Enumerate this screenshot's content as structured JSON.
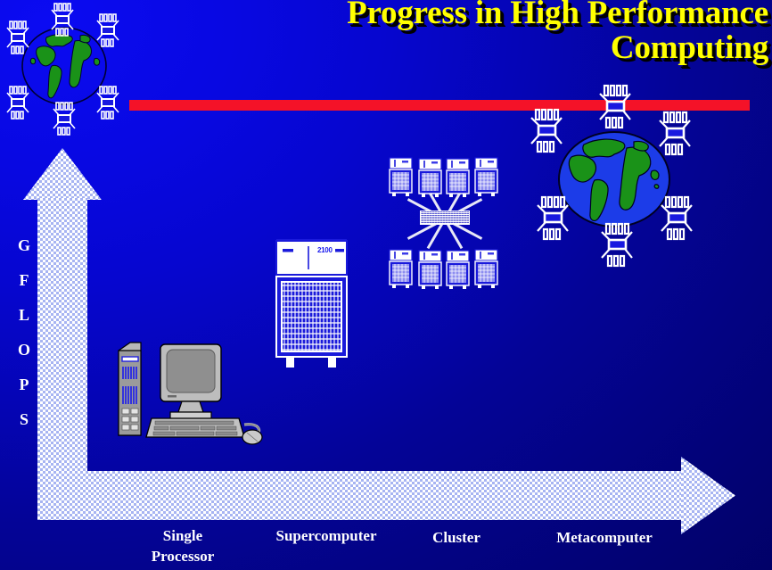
{
  "slide": {
    "title_line1": "Progress in High Performance",
    "title_line2": "Computing",
    "title_color": "#ffff00",
    "title_shadow_color": "#000000",
    "background_color_bright": "#0b0bf2",
    "background_color_dark": "#010166",
    "accent_bar_color": "#f41228"
  },
  "axes": {
    "y_axis_letters": [
      "G",
      "F",
      "L",
      "O",
      "P",
      "S"
    ],
    "y_axis_name": "GFLOPS",
    "x_axis_labels": [
      {
        "text": "Single\nProcessor",
        "name": "single-processor"
      },
      {
        "text": "Supercomputer",
        "name": "supercomputer"
      },
      {
        "text": "Cluster",
        "name": "cluster"
      },
      {
        "text": "Metacomputer",
        "name": "metacomputer"
      }
    ],
    "arrow_fill_color": "#a7b4f2",
    "label_color": "#ffffff"
  },
  "graphics": {
    "supercomputer_model_label": "2100",
    "cluster_node_count": 8,
    "globe_chip_count_left": 6,
    "globe_chip_count_right": 6,
    "globe_land_color": "#1a9218",
    "globe_ocean_color": "#1c3ce8",
    "chip_color": "#ffffff",
    "pc_case_color": "#a0a0a0"
  },
  "chart_data": {
    "type": "scatter",
    "title": "Progress in High Performance Computing",
    "xlabel": "",
    "ylabel": "GFLOPS",
    "categories": [
      "Single Processor",
      "Supercomputer",
      "Cluster",
      "Metacomputer"
    ],
    "values": [
      1,
      2,
      3,
      4
    ],
    "annotations": [
      "Single Processor - desktop PC",
      "Supercomputer - single cabinet model 2100",
      "Cluster - 8 nodes connected via central switch",
      "Metacomputer - globally distributed CPUs around the world"
    ],
    "grid": false,
    "legend": "none"
  }
}
